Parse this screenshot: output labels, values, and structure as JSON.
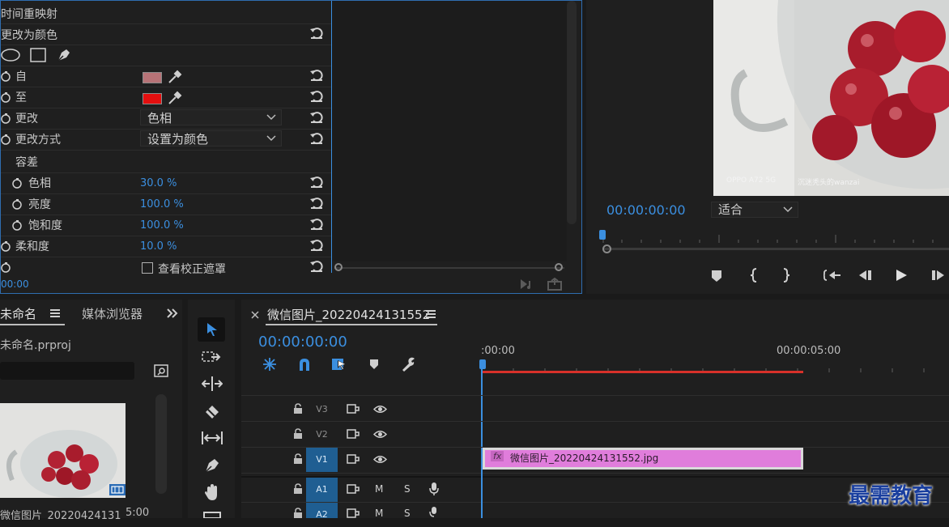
{
  "effect_controls": {
    "group_time_remap": "时间重映射",
    "group_change_color": "更改为颜色",
    "from_label": "自",
    "to_label": "至",
    "change_label": "更改",
    "change_value": "色相",
    "change_by_label": "更改方式",
    "change_by_value": "设置为颜色",
    "tolerance_label": "容差",
    "hue_label": "色相",
    "hue_value": "30.0 %",
    "lightness_label": "亮度",
    "lightness_value": "100.0 %",
    "saturation_label": "饱和度",
    "saturation_value": "100.0 %",
    "softness_label": "柔和度",
    "softness_value": "10.0 %",
    "view_mask_label": "查看校正遮罩",
    "timecode": "00:00",
    "from_color": "#b77377",
    "to_color": "#e40f0f"
  },
  "program_monitor": {
    "timecode": "00:00:00:00",
    "fit_value": "适合",
    "watermark_left": "OPPO A72 5G",
    "watermark_right": "沉迷秃头的wanzai"
  },
  "project_panel": {
    "tab_untitled": "未命名",
    "tab_media_browser": "媒体浏览器",
    "project_file": "未命名.prproj",
    "clip_name": "微信图片_20220424131...",
    "clip_duration": "5:00"
  },
  "timeline": {
    "sequence_name": "微信图片_20220424131552",
    "timecode": "00:00:00:00",
    "ruler_start": ":00:00",
    "ruler_5s": "00:00:05:00",
    "tracks": [
      {
        "name": "V3",
        "active": false
      },
      {
        "name": "V2",
        "active": false
      },
      {
        "name": "V1",
        "active": true
      },
      {
        "name": "A1",
        "active": true
      },
      {
        "name": "A2",
        "active": true
      }
    ],
    "audio_m": "M",
    "audio_s": "S",
    "clip_label": "微信图片_20220424131552.jpg",
    "clip_fx": "fx"
  },
  "brand_watermark": "最需教育",
  "colors": {
    "accent_blue": "#3b8fe0",
    "clip_pink": "#e07ddb",
    "work_area_red": "#d8302a",
    "track_blue": "#1f5e92"
  }
}
